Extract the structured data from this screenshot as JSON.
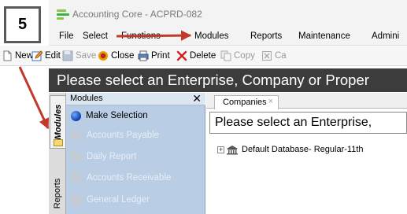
{
  "window": {
    "title": "Accounting Core - ACPRD-082"
  },
  "menu": {
    "items": [
      "File",
      "Select",
      "Functions",
      "Modules",
      "Reports",
      "Maintenance",
      "Admini"
    ]
  },
  "toolbar": {
    "buttons": [
      {
        "label": "New",
        "icon": "new-document-icon",
        "enabled": true
      },
      {
        "label": "Edit",
        "icon": "edit-icon",
        "enabled": true
      },
      {
        "label": "Save",
        "icon": "save-icon",
        "enabled": false
      },
      {
        "label": "Close",
        "icon": "close-icon",
        "enabled": true
      },
      {
        "label": "Print",
        "icon": "printer-icon",
        "enabled": true
      },
      {
        "label": "Delete",
        "icon": "delete-icon",
        "enabled": true
      },
      {
        "label": "Copy",
        "icon": "copy-icon",
        "enabled": false
      },
      {
        "label": "Ca",
        "icon": "cancel-icon",
        "enabled": false
      }
    ]
  },
  "banner": {
    "text": "Please select an Enterprise, Company or Proper"
  },
  "side_tabs": [
    "Modules",
    "Reports"
  ],
  "modules_panel": {
    "title": "Modules",
    "close_glyph": "✕",
    "items": [
      {
        "label": "Make Selection",
        "icon": "globe-icon",
        "enabled": true
      },
      {
        "label": "Accounts Payable",
        "icon": "folder-icon",
        "enabled": false
      },
      {
        "label": "Daily Report",
        "icon": "folder-icon",
        "enabled": false
      },
      {
        "label": "Accounts Receivable",
        "icon": "folder-icon",
        "enabled": false
      },
      {
        "label": "General Ledger",
        "icon": "folder-icon",
        "enabled": false
      }
    ]
  },
  "content": {
    "tab_label": "Companies",
    "tab_close_glyph": "×",
    "header_text": "Please select an Enterprise,",
    "tree": {
      "expander": "+",
      "label": "Default Database- Regular-11th"
    }
  },
  "callout": {
    "number": "5"
  },
  "colors": {
    "callout_arrow": "#c0392b",
    "banner_bg": "#3c3c3c",
    "modules_bg": "#b9cde4"
  }
}
